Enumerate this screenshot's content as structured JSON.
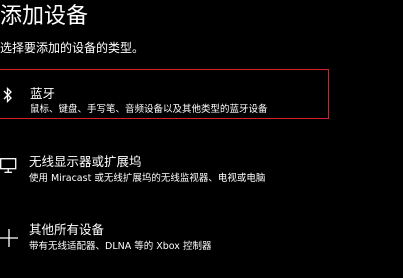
{
  "page": {
    "title": "添加设备",
    "subtitle": "选择要添加的设备的类型。"
  },
  "options": [
    {
      "icon": "bluetooth-icon",
      "title": "蓝牙",
      "description": "鼠标、键盘、手写笔、音频设备以及其他类型的蓝牙设备",
      "selected": true
    },
    {
      "icon": "monitor-icon",
      "title": "无线显示器或扩展坞",
      "description": "使用 Miracast 或无线扩展坞的无线监视器、电视或电脑",
      "selected": false
    },
    {
      "icon": "plus-icon",
      "title": "其他所有设备",
      "description": "带有无线适配器、DLNA 等的 Xbox 控制器",
      "selected": false
    }
  ],
  "colors": {
    "background": "#000000",
    "text": "#ffffff",
    "selection_border": "#d8202a"
  }
}
